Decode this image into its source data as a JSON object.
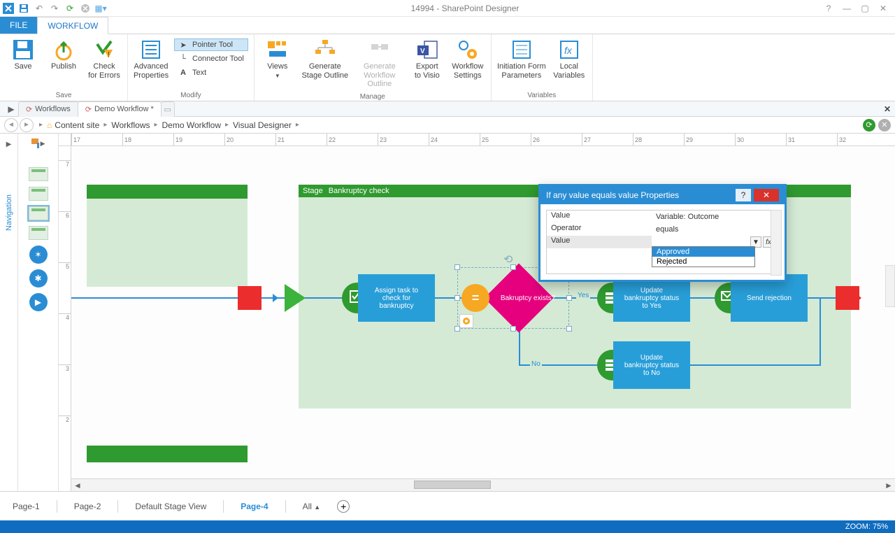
{
  "title": "14994 - SharePoint Designer",
  "tabs": {
    "file": "FILE",
    "workflow": "WORKFLOW"
  },
  "ribbon": {
    "save": {
      "save": "Save",
      "publish": "Publish",
      "check": "Check\nfor Errors",
      "group": "Save"
    },
    "modify": {
      "advanced": "Advanced\nProperties",
      "pointer": "Pointer Tool",
      "connector": "Connector Tool",
      "text": "Text",
      "group": "Modify"
    },
    "manage": {
      "views": "Views",
      "generate_stage": "Generate\nStage Outline",
      "generate_wf": "Generate\nWorkflow Outline",
      "export": "Export\nto Visio",
      "settings": "Workflow\nSettings",
      "group": "Manage"
    },
    "variables": {
      "initiation": "Initiation Form\nParameters",
      "local": "Local\nVariables",
      "group": "Variables"
    }
  },
  "doc_tabs": {
    "t1": "Workflows",
    "t2": "Demo Workflow *"
  },
  "breadcrumb": {
    "c1": "Content site",
    "c2": "Workflows",
    "c3": "Demo Workflow",
    "c4": "Visual Designer"
  },
  "side": {
    "nav": "Navigation"
  },
  "stage": {
    "stage_label": "Stage",
    "stage_name": "Bankruptcy check",
    "assign": "Assign task to\ncheck for\nbankruptcy",
    "decision": "Bakruptcy exists?",
    "yes": "Yes",
    "no": "No",
    "update_yes": "Update\nbankruptcy status\nto Yes",
    "update_no": "Update\nbankruptcy status\nto No",
    "send_rejection": "Send rejection"
  },
  "props": {
    "title": "If any value equals value Properties",
    "rows": {
      "value1": {
        "k": "Value",
        "v": "Variable: Outcome"
      },
      "operator": {
        "k": "Operator",
        "v": "equals"
      },
      "value2": {
        "k": "Value",
        "v": ""
      }
    },
    "options": {
      "approved": "Approved",
      "rejected": "Rejected"
    }
  },
  "pages": {
    "p1": "Page-1",
    "p2": "Page-2",
    "p3": "Default Stage View",
    "p4": "Page-4",
    "all": "All"
  },
  "status": {
    "zoom": "ZOOM: 75%"
  },
  "ruler_h": [
    "17",
    "18",
    "19",
    "20",
    "21",
    "22",
    "23",
    "24",
    "25",
    "26",
    "27",
    "28",
    "29",
    "30",
    "31",
    "32"
  ],
  "ruler_v": [
    "7",
    "6",
    "5",
    "4",
    "3",
    "2"
  ]
}
